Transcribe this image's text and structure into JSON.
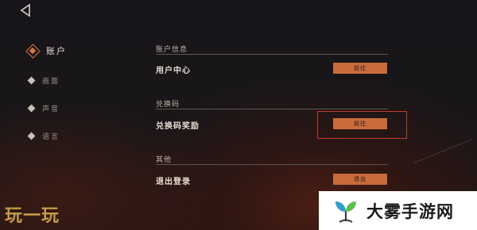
{
  "sidebar": {
    "items": [
      {
        "label": "账户",
        "active": true
      },
      {
        "label": "画面",
        "active": false
      },
      {
        "label": "声音",
        "active": false
      },
      {
        "label": "语言",
        "active": false
      }
    ]
  },
  "sections": {
    "account": {
      "title": "账户信息",
      "row_label": "用户中心",
      "button": "前往"
    },
    "redeem": {
      "title": "兑换码",
      "row_label": "兑换码奖励",
      "button": "前往"
    },
    "other": {
      "title": "其他",
      "row_label": "退出登录",
      "button": "退出"
    }
  },
  "watermarks": {
    "left": "玩一玩",
    "right": "大雾手游网"
  },
  "colors": {
    "accent": "#c86b3a",
    "highlight": "#c23b33"
  }
}
